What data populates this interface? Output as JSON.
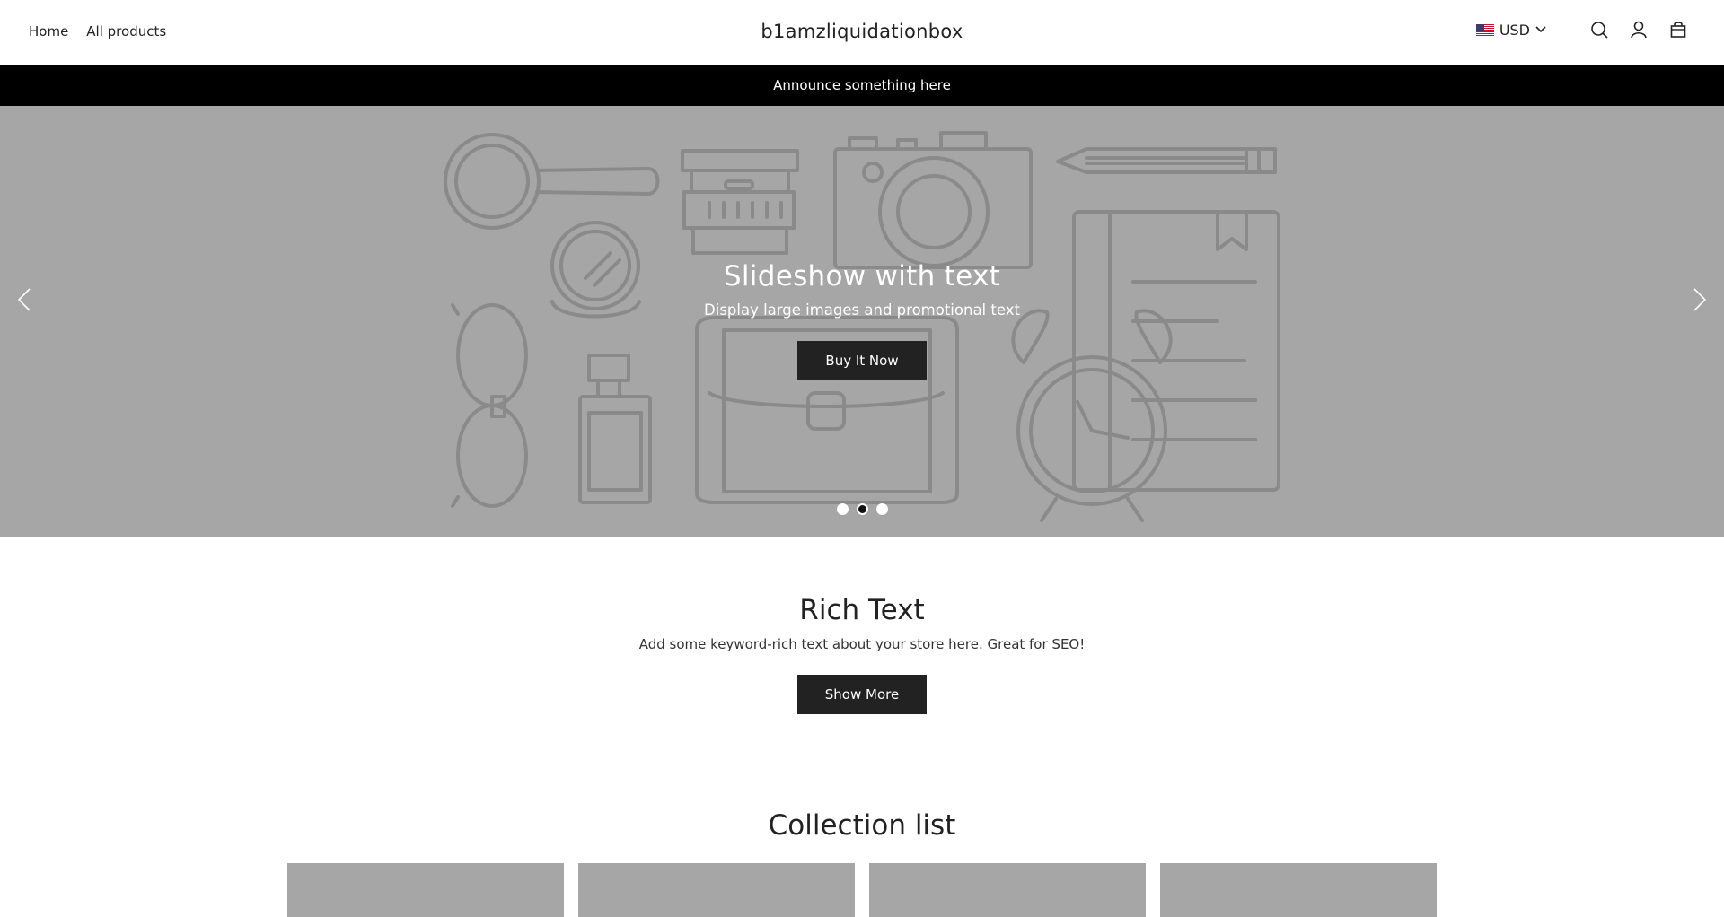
{
  "header": {
    "nav": [
      {
        "label": "Home"
      },
      {
        "label": "All products"
      }
    ],
    "logo": "b1amzliquidationbox",
    "currency": {
      "code": "USD",
      "flag_icon": "us-flag-icon"
    },
    "icons": [
      "search-icon",
      "account-icon",
      "cart-icon"
    ]
  },
  "announcement": {
    "text": "Announce something here"
  },
  "slideshow": {
    "title": "Slideshow with text",
    "subtitle": "Display large images and promotional text",
    "button_label": "Buy It Now",
    "active_slide": 2,
    "slide_count": 3,
    "background_color": "#a6a6a6"
  },
  "rich_text": {
    "title": "Rich Text",
    "body": "Add some keyword-rich text about your store here. Great for SEO!",
    "button_label": "Show More"
  },
  "collection_list": {
    "title": "Collection list",
    "card_count": 4
  },
  "colors": {
    "button_bg": "#222222",
    "announcement_bg": "#000000",
    "placeholder_grey": "#a6a6a6"
  }
}
